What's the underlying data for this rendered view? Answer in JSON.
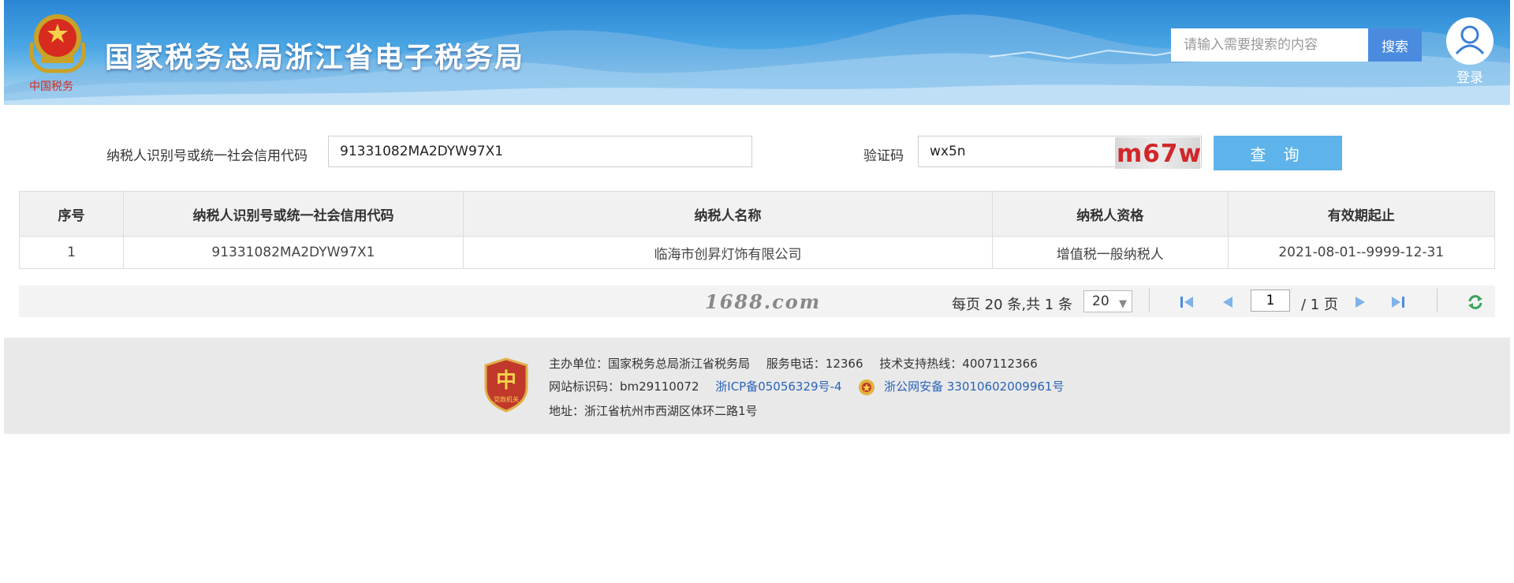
{
  "header": {
    "site_title": "国家税务总局浙江省电子税务局",
    "emblem_caption": "中国税务",
    "search_placeholder": "请输入需要搜索的内容",
    "search_button": "搜索",
    "login_label": "登录"
  },
  "query_form": {
    "taxpayer_id_label": "纳税人识别号或统一社会信用代码",
    "taxpayer_id_value": "91331082MA2DYW97X1",
    "captcha_label": "验证码",
    "captcha_value": "wx5n",
    "captcha_image_text": "m67w",
    "query_button": "查 询"
  },
  "results_table": {
    "columns": [
      "序号",
      "纳税人识别号或统一社会信用代码",
      "纳税人名称",
      "纳税人资格",
      "有效期起止"
    ],
    "rows": [
      [
        "1",
        "91331082MA2DYW97X1",
        "临海市创昇灯饰有限公司",
        "增值税一般纳税人",
        "2021-08-01--9999-12-31"
      ]
    ]
  },
  "pager": {
    "watermark": "1688.com",
    "summary": "每页 20 条,共 1 条",
    "page_size": "20",
    "current_page": "1",
    "total_pages": "/ 1 页"
  },
  "footer": {
    "badge_caption": "党政机关",
    "sponsor": "主办单位：国家税务总局浙江省税务局",
    "service_phone": "服务电话：12366",
    "support_hotline": "技术支持热线：4007112366",
    "site_id": "网站标识码：bm29110072",
    "icp": "浙ICP备05056329号-4",
    "police_record": "浙公网安备 33010602009961号",
    "address": "地址：浙江省杭州市西湖区体环二路1号"
  },
  "colors": {
    "header_blue": "#2a86d4",
    "search_button": "#4a8be0",
    "query_button": "#5eb3ea",
    "captcha_text": "#d1262a",
    "footer_bg": "#e9e9e9",
    "link": "#2a63b8"
  }
}
